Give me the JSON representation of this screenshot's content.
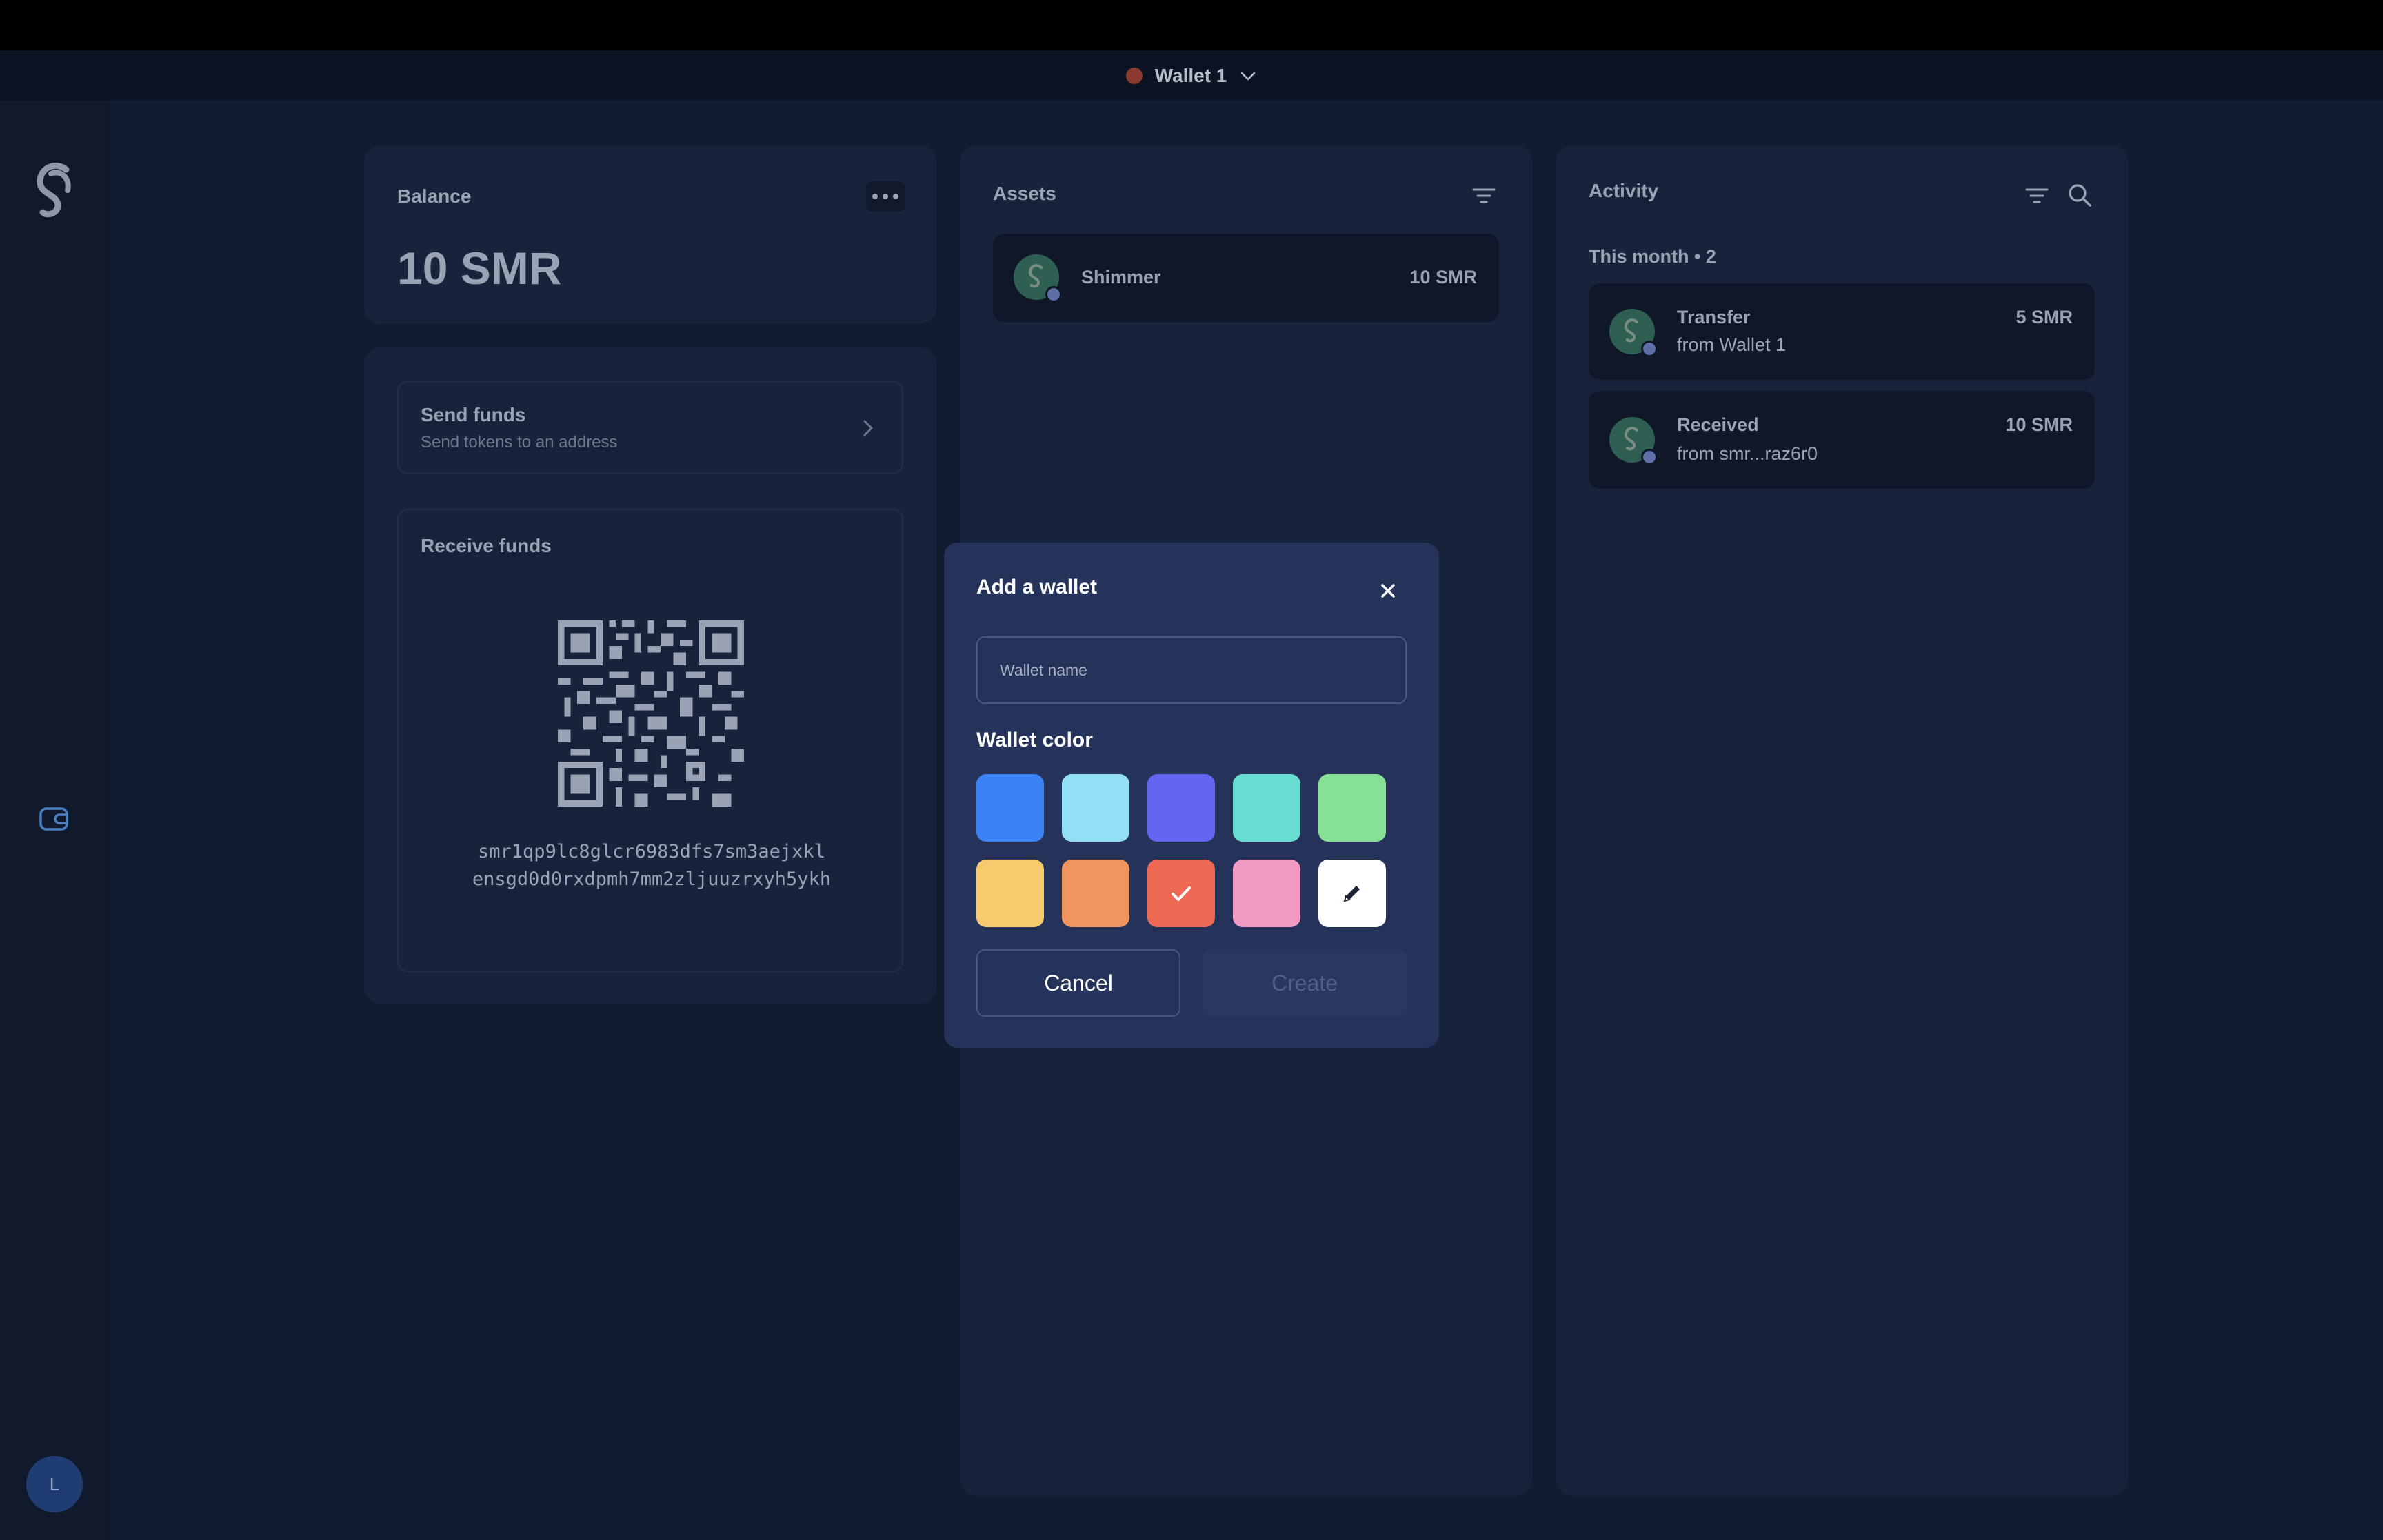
{
  "header": {
    "wallet_name": "Wallet 1",
    "wallet_dot_color": "#8a3a31"
  },
  "sidebar": {
    "avatar_initial": "L"
  },
  "balance": {
    "title": "Balance",
    "amount": "10 SMR"
  },
  "send": {
    "title": "Send funds",
    "subtitle": "Send tokens to an address"
  },
  "receive": {
    "title": "Receive funds",
    "address_line1": "smr1qp9lc8glcr6983dfs7sm3aejxkl",
    "address_line2": "ensgd0d0rxdpmh7mm2zljuuzrxyh5ykh"
  },
  "assets": {
    "title": "Assets",
    "items": [
      {
        "name": "Shimmer",
        "amount": "10 SMR"
      }
    ]
  },
  "activity": {
    "title": "Activity",
    "group_label": "This month • 2",
    "items": [
      {
        "type": "Transfer",
        "detail": "from Wallet 1",
        "amount": "5 SMR"
      },
      {
        "type": "Received",
        "detail": "from smr...raz6r0",
        "amount": "10 SMR"
      }
    ]
  },
  "modal": {
    "title": "Add a wallet",
    "name_placeholder": "Wallet name",
    "name_value": "",
    "color_label": "Wallet color",
    "colors": [
      "#3b82f6",
      "#93dff8",
      "#6366f1",
      "#67ddd0",
      "#86e096",
      "#f7cc6e",
      "#f09460",
      "#ee6a55",
      "#f29ac4",
      "#ffffff"
    ],
    "selected_color": "#ee6a55",
    "cancel_label": "Cancel",
    "create_label": "Create"
  }
}
